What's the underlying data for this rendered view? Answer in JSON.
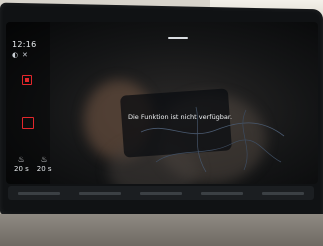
{
  "status": {
    "time": "12:16"
  },
  "sidebar": {
    "seats": [
      {
        "icon": "seat-heat-icon",
        "value": "20 s"
      },
      {
        "icon": "seat-heat-icon",
        "value": "20 s"
      }
    ]
  },
  "main": {
    "message": "Die Funktion ist nicht verfügbar."
  },
  "colors": {
    "accent": "#e2272b",
    "screen_bg": "#141516",
    "text": "#f1f3f5"
  }
}
